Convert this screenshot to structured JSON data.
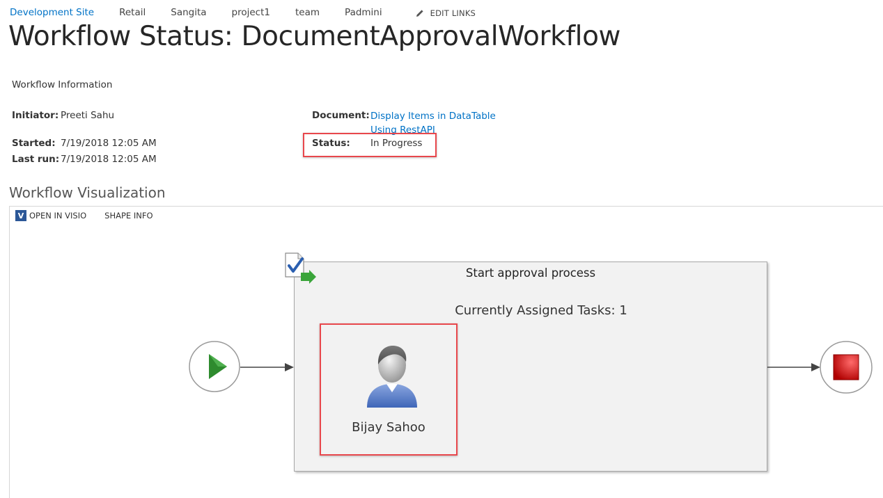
{
  "nav": {
    "items": [
      "Development Site",
      "Retail",
      "Sangita",
      "project1",
      "team",
      "Padmini"
    ],
    "edit_links": "EDIT LINKS"
  },
  "page": {
    "title": "Workflow Status: DocumentApprovalWorkflow"
  },
  "info": {
    "section_label": "Workflow Information",
    "initiator_label": "Initiator:",
    "initiator_value": "Preeti Sahu",
    "started_label": "Started:",
    "started_value": "7/19/2018 12:05 AM",
    "last_run_label": "Last run:",
    "last_run_value": "7/19/2018 12:05 AM",
    "document_label": "Document:",
    "document_value": "Display Items in DataTable Using RestAPI",
    "status_label": "Status:",
    "status_value": "In Progress"
  },
  "visualization": {
    "heading": "Workflow Visualization",
    "toolbar": {
      "open_in_visio": "OPEN IN VISIO",
      "visio_glyph": "V",
      "shape_info": "SHAPE INFO"
    },
    "stage_title": "Start approval process",
    "tasks_label": "Currently Assigned Tasks: 1",
    "assignee": "Bijay Sahoo"
  },
  "colors": {
    "link": "#0072c6",
    "highlight": "#e8474c",
    "start_green": "#2e8b2e",
    "stop_red": "#cc1111",
    "visio_blue": "#2b5797"
  },
  "icons": [
    "pencil-icon",
    "visio-icon",
    "task-document-icon",
    "start-play-icon",
    "stop-icon",
    "user-avatar-icon",
    "arrow-icon"
  ]
}
